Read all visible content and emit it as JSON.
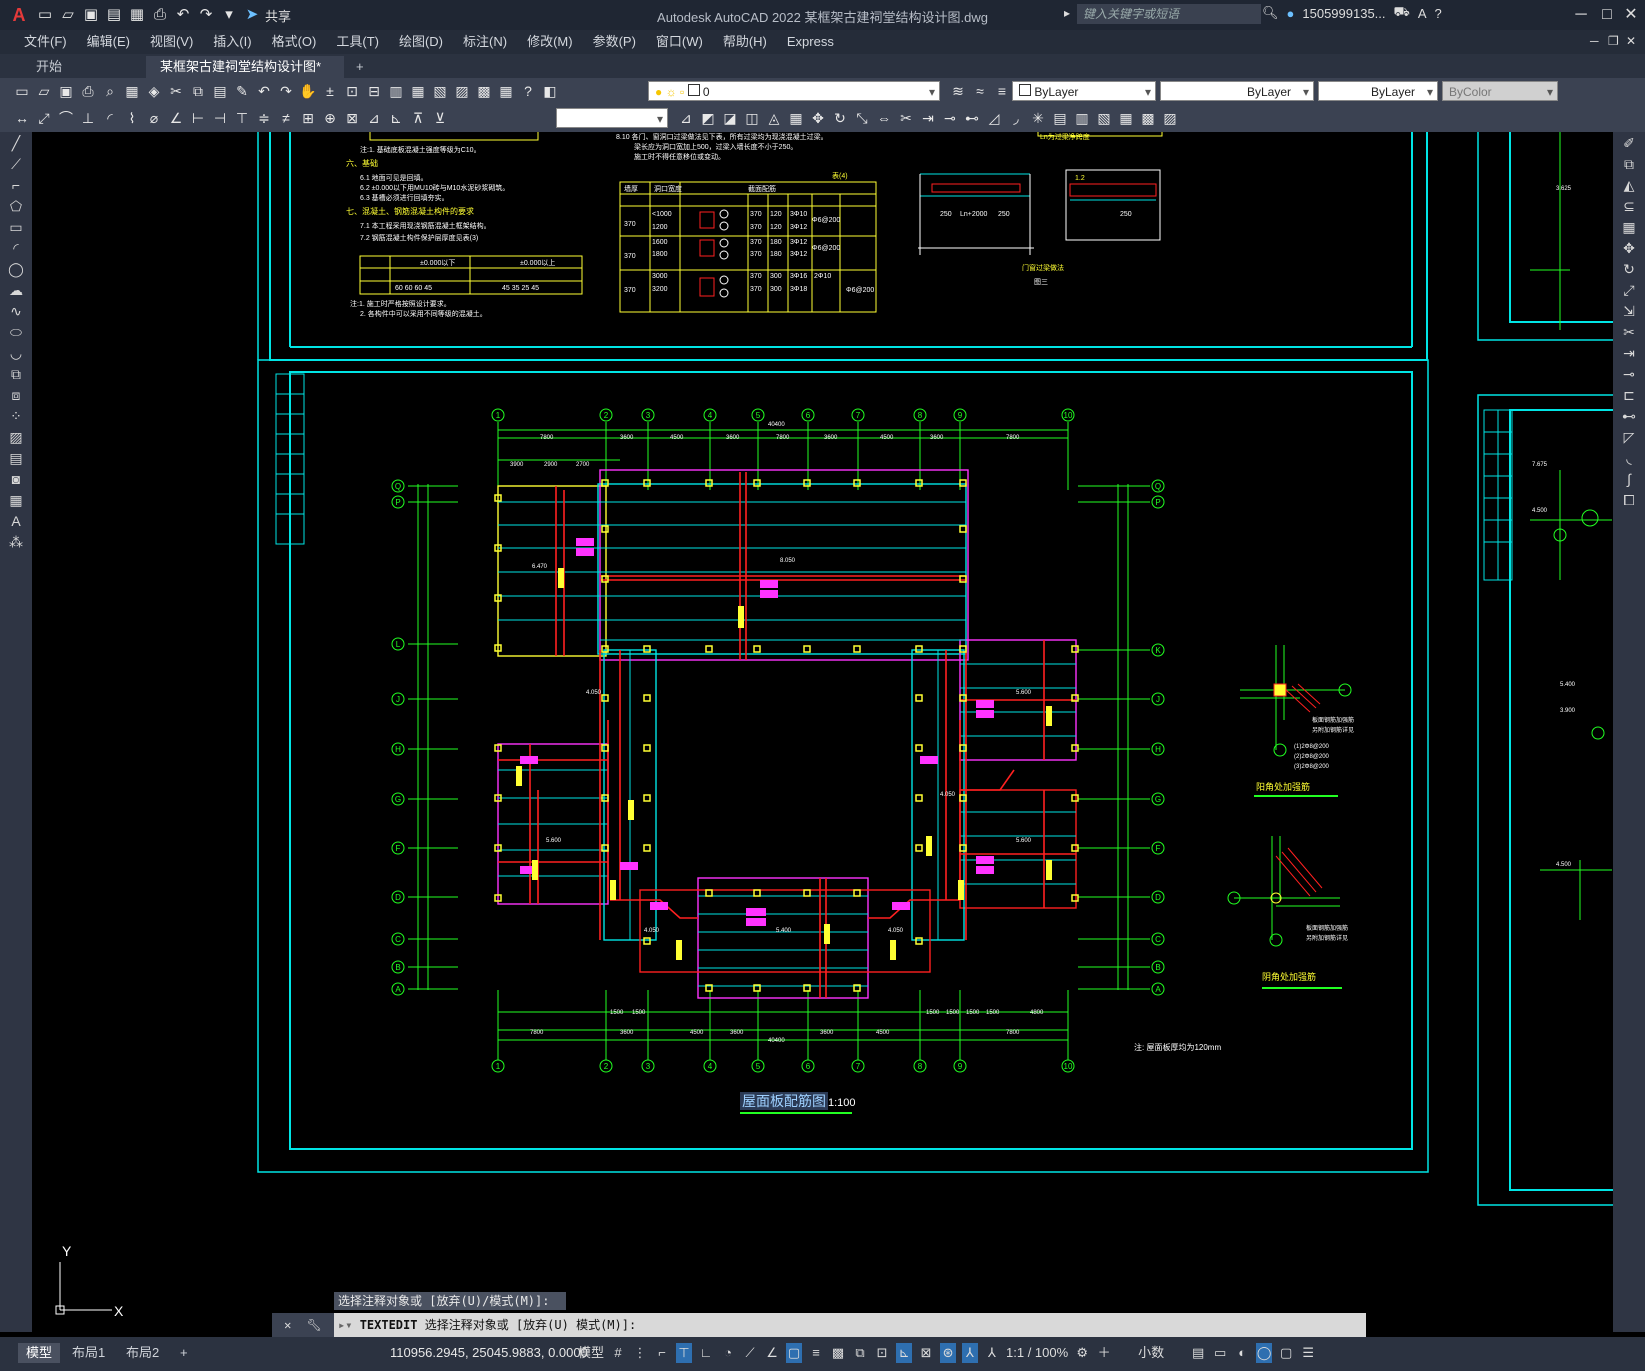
{
  "app": {
    "logo": "A",
    "title": "Autodesk AutoCAD 2022    某框架古建祠堂结构设计图.dwg",
    "share_label": "共享",
    "search_placeholder": "键入关键字或短语",
    "user": "1505999135...",
    "window_buttons": [
      "minimize-icon",
      "restore-icon",
      "close-icon"
    ]
  },
  "menu": [
    "文件(F)",
    "编辑(E)",
    "视图(V)",
    "插入(I)",
    "格式(O)",
    "工具(T)",
    "绘图(D)",
    "标注(N)",
    "修改(M)",
    "参数(P)",
    "窗口(W)",
    "帮助(H)",
    "Express"
  ],
  "tabs": {
    "start": "开始",
    "doc": "某框架古建祠堂结构设计图*",
    "add": "+"
  },
  "properties": {
    "layer": "0",
    "color": "ByLayer",
    "linetype": "ByLayer",
    "lineweight": "ByLayer",
    "plotstyle": "ByColor"
  },
  "drawing": {
    "title": "屋面板配筋图",
    "scale": "1:100",
    "note": "注: 屋面板厚均为120mm",
    "detail1": "阳角处加强筋",
    "detail2": "阴角处加强筋",
    "gate_title": "门窗过梁做法",
    "figure_label": "图三",
    "top_grid": [
      "1",
      "2",
      "3",
      "4",
      "5",
      "6",
      "7",
      "8",
      "9",
      "10"
    ],
    "left_grid": [
      "Q",
      "P",
      "L",
      "J",
      "H",
      "G",
      "F",
      "D",
      "C",
      "B",
      "A"
    ],
    "right_grid": [
      "Q",
      "P",
      "K",
      "J",
      "H",
      "G",
      "F",
      "D",
      "C",
      "B",
      "A"
    ],
    "overall_dim": "40400",
    "table_title": "表(4)",
    "table_headers": [
      "墙厚(mm)",
      "洞口宽度(mm)",
      "截面形式",
      "b",
      "h",
      "①",
      "②",
      "③"
    ],
    "table_rows": [
      [
        "370",
        "<1000",
        "",
        "370",
        "120",
        "3Φ10",
        ""
      ],
      [
        "",
        "1200",
        "",
        "370",
        "120",
        "3Φ12",
        "Φ6@200"
      ],
      [
        "370",
        "1600",
        "",
        "370",
        "180",
        "3Φ12",
        "Φ6@200"
      ],
      [
        "",
        "1800",
        "",
        "370",
        "180",
        "3Φ12",
        ""
      ],
      [
        "370",
        "3000",
        "",
        "370",
        "300",
        "3Φ16",
        "2Φ10"
      ],
      [
        "",
        "3200",
        "",
        "370",
        "300",
        "3Φ18",
        "Φ6@200"
      ]
    ]
  },
  "command": {
    "history": "选择注释对象或 [放弃(U)/模式(M)]:",
    "current_cmd": "TEXTEDIT",
    "current_prompt": "选择注释对象或 [放弃(U) 模式(M)]:"
  },
  "status": {
    "layout_tabs": [
      "模型",
      "布局1",
      "布局2"
    ],
    "coords": "110956.2945, 25045.9883, 0.0000",
    "model_label": "模型",
    "scale": "1:1 / 100%",
    "units": "小数"
  },
  "ucs": {
    "x": "X",
    "y": "Y"
  },
  "colors": {
    "green": "#22ff22",
    "cyan": "#00e5e5",
    "yellow": "#ffff33",
    "red": "#ff2020",
    "magenta": "#ff33ff",
    "white": "#ffffff"
  }
}
